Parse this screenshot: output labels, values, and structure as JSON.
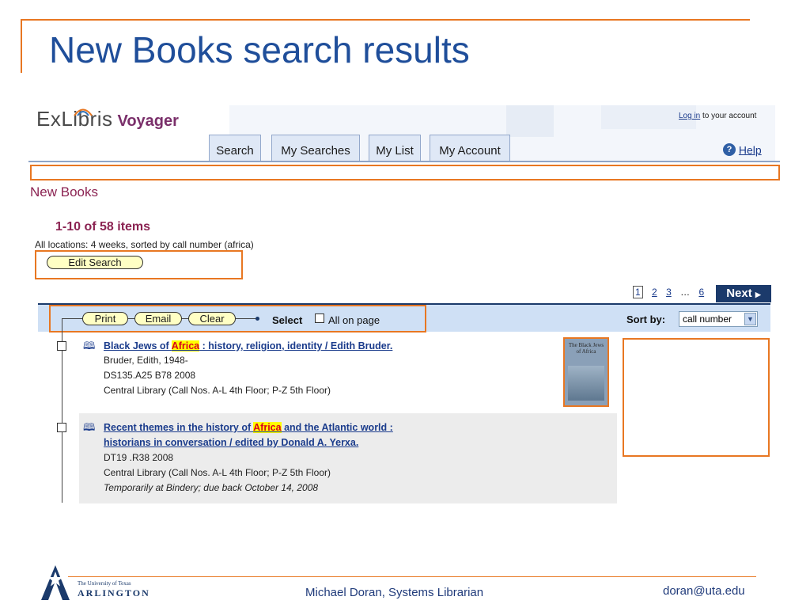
{
  "slide": {
    "title": "New Books search results",
    "footer_center": "Michael Doran, Systems Librarian",
    "footer_right": "doran@uta.edu",
    "logo_line1": "The University of Texas",
    "logo_line2": "ARLINGTON",
    "accent_color": "#e87722",
    "title_color": "#1f4e9a"
  },
  "header": {
    "logo_exlibris": "ExLibris",
    "logo_voyager": "Voyager",
    "login_link": "Log in",
    "login_text": "to your account",
    "help": "Help",
    "tabs": [
      "Search",
      "My Searches",
      "My List",
      "My Account"
    ]
  },
  "page": {
    "heading": "New Books",
    "count": "1-10 of 58 items",
    "search_desc": "All locations: 4 weeks, sorted by call number (africa)",
    "edit_search": "Edit Search"
  },
  "pager": {
    "current": "1",
    "pages": [
      "2",
      "3"
    ],
    "ellipsis": "…",
    "last": "6",
    "next": "Next"
  },
  "toolbar": {
    "print": "Print",
    "email": "Email",
    "clear": "Clear",
    "select_label": "Select",
    "all_on_page": "All on page",
    "sort_label": "Sort by:",
    "sort_value": "call number"
  },
  "results": [
    {
      "title_before": "Black Jews of ",
      "title_hit": "Africa",
      "title_after": " : history, religion, identity / Edith Bruder.",
      "author": "Bruder, Edith, 1948-",
      "call_number": "DS135.A25 B78 2008",
      "location": "Central Library (Call Nos. A-L 4th Floor; P-Z 5th Floor)",
      "cover_text": "The Black Jews of Africa"
    },
    {
      "title_before": "Recent themes in the history of ",
      "title_hit": "Africa",
      "title_after": " and the Atlantic world :",
      "title_line2": "historians in conversation / edited by Donald A. Yerxa.",
      "call_number": "DT19 .R38 2008",
      "location": "Central Library (Call Nos. A-L 4th Floor; P-Z 5th Floor)",
      "status": "Temporarily at Bindery; due back October 14, 2008"
    }
  ]
}
